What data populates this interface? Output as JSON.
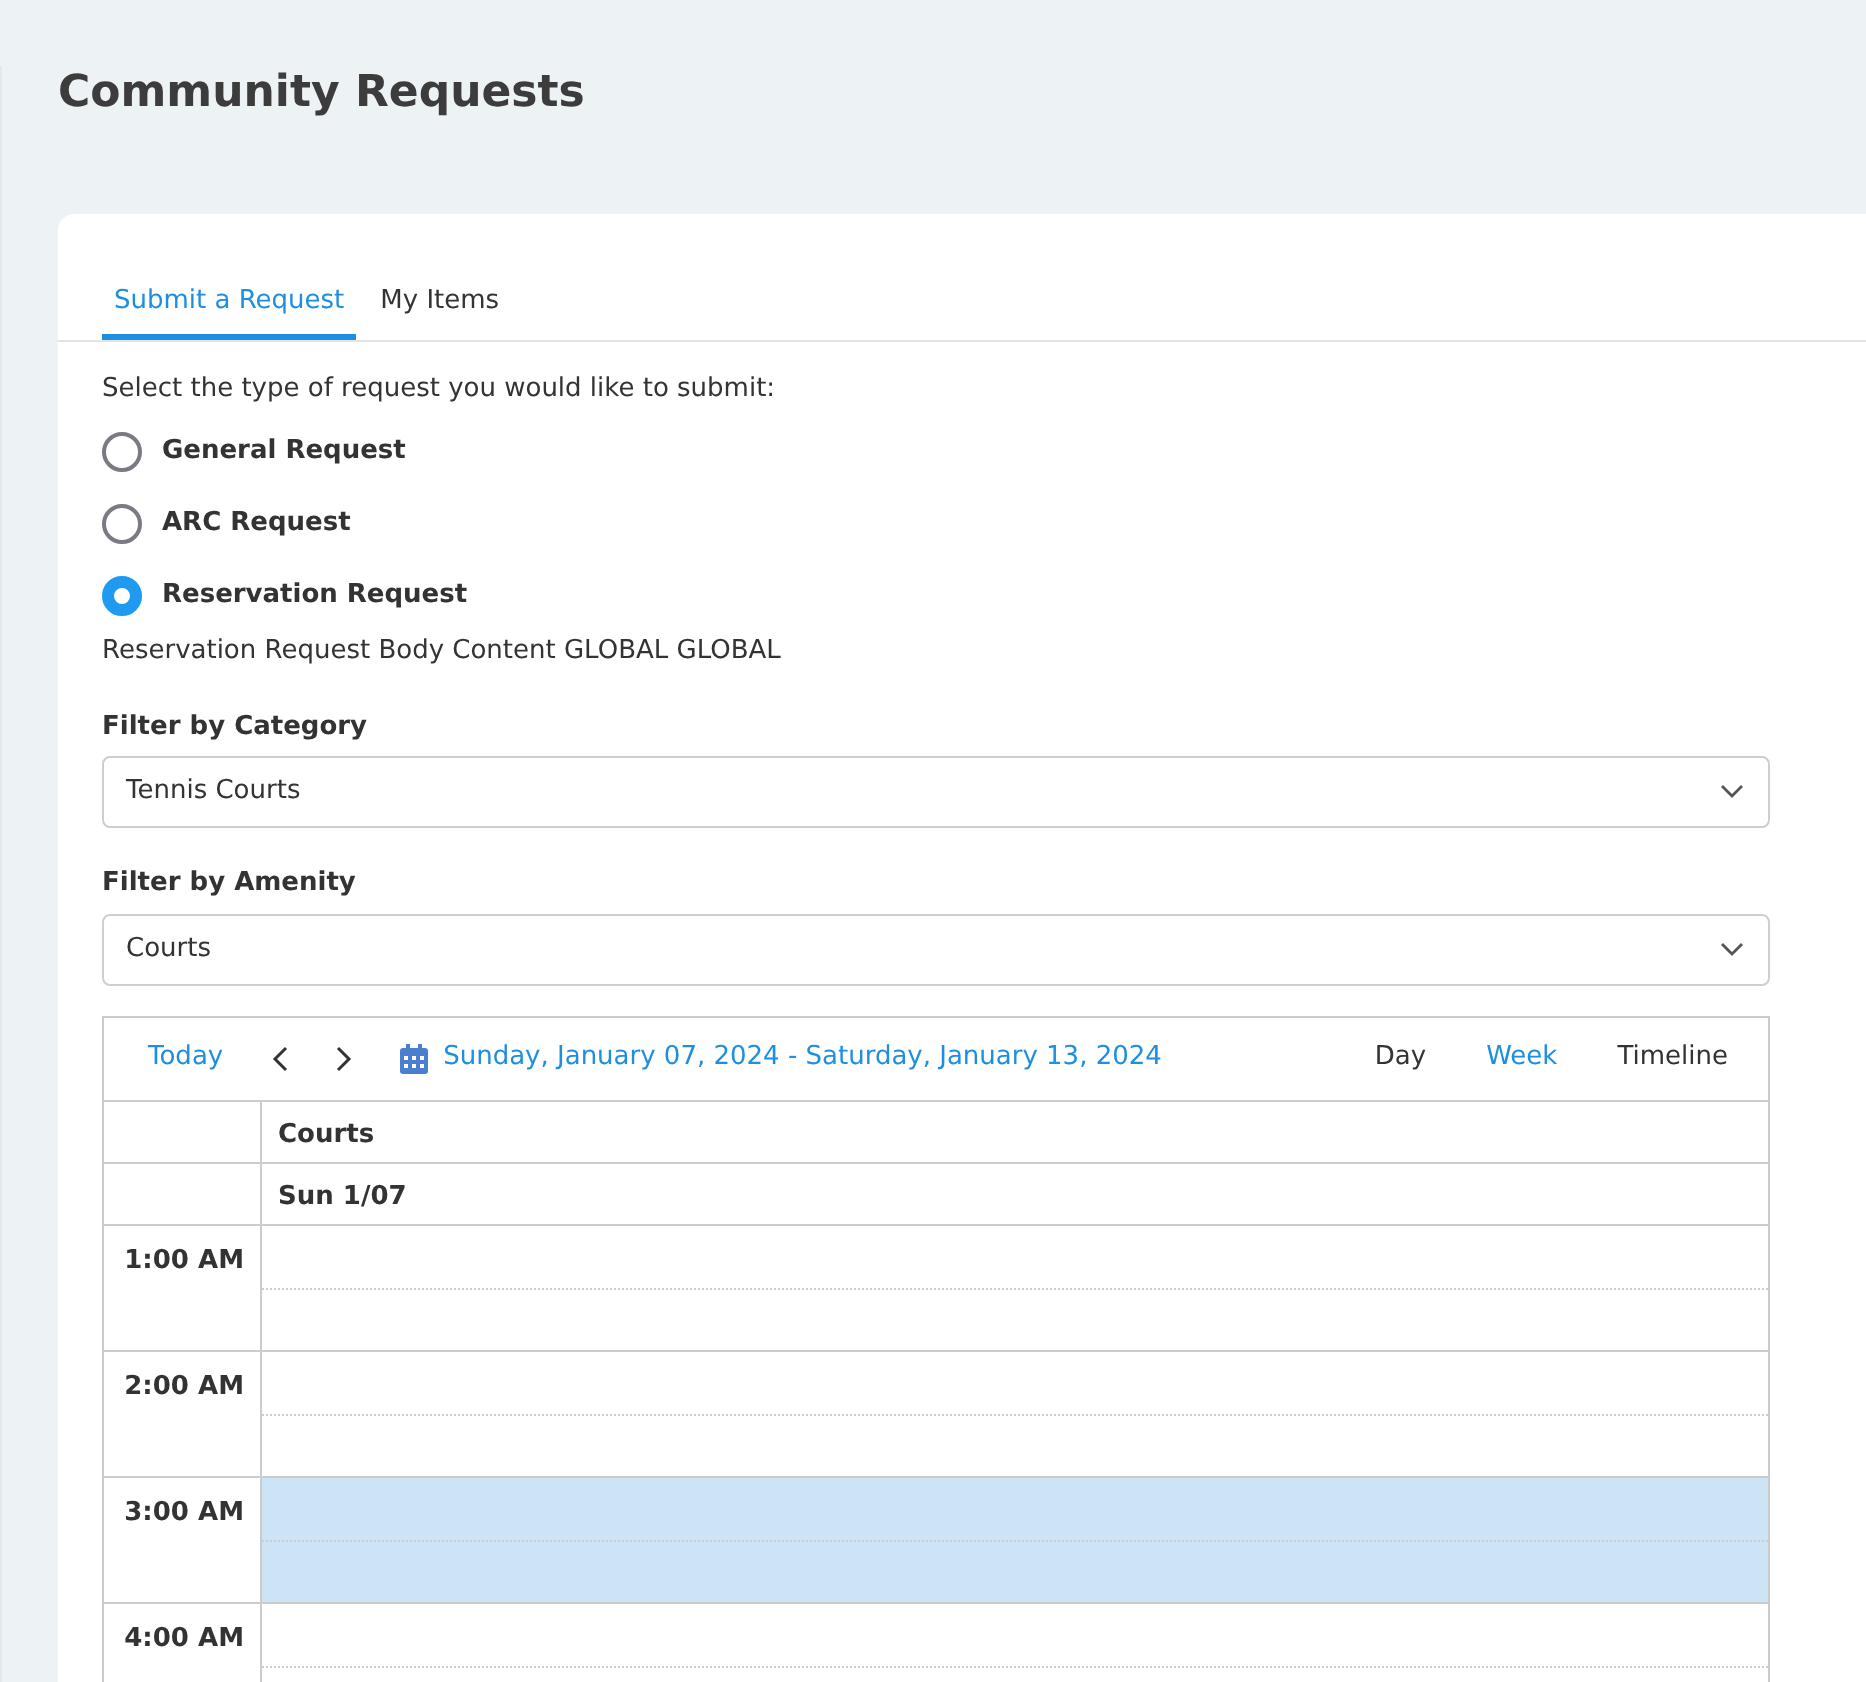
{
  "page_title": "Community Requests",
  "tabs": [
    {
      "label": "Submit a Request",
      "selected": true
    },
    {
      "label": "My Items",
      "selected": false
    }
  ],
  "prompt": "Select the type of request you would like to submit:",
  "request_types": [
    {
      "label": "General Request",
      "selected": false
    },
    {
      "label": "ARC Request",
      "selected": false
    },
    {
      "label": "Reservation Request",
      "selected": true
    }
  ],
  "body_content": "Reservation Request Body Content GLOBAL GLOBAL",
  "filters": [
    {
      "label": "Filter by Category",
      "value": "Tennis Courts"
    },
    {
      "label": "Filter by Amenity",
      "value": "Courts"
    }
  ],
  "scheduler": {
    "today": "Today",
    "date_range": "Sunday, January 07, 2024 - Saturday, January 13, 2024",
    "views": [
      {
        "label": "Day",
        "selected": false
      },
      {
        "label": "Week",
        "selected": true
      },
      {
        "label": "Timeline",
        "selected": false
      }
    ],
    "resource": "Courts",
    "day": "Sun 1/07",
    "slots": [
      {
        "time": "1:00 AM",
        "selected": false
      },
      {
        "time": "2:00 AM",
        "selected": false
      },
      {
        "time": "3:00 AM",
        "selected": true
      },
      {
        "time": "4:00 AM",
        "selected": false
      }
    ]
  }
}
